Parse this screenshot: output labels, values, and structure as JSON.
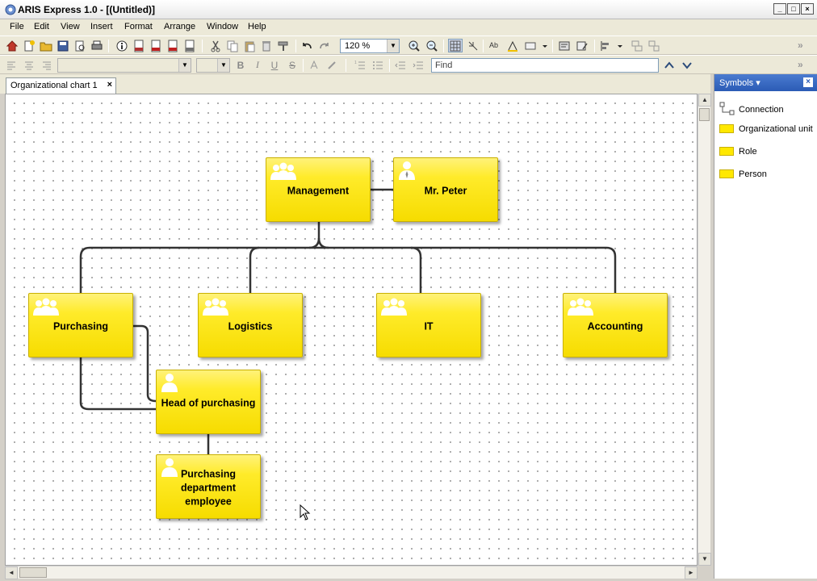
{
  "window": {
    "title": "ARIS Express 1.0 - [(Untitled)]",
    "minimize": "_",
    "maximize": "□",
    "close": "×"
  },
  "menu": [
    "File",
    "Edit",
    "View",
    "Insert",
    "Format",
    "Arrange",
    "Window",
    "Help"
  ],
  "toolbar": {
    "zoom": "120 %",
    "find_placeholder": "Find",
    "bold": "B",
    "italic": "I",
    "underline": "U",
    "strike": "S"
  },
  "tab": {
    "label": "Organizational chart 1",
    "close": "×"
  },
  "diagram": {
    "nodes": [
      {
        "label": "Management",
        "kind": "organizational-unit"
      },
      {
        "label": "Mr. Peter",
        "kind": "person"
      },
      {
        "label": "Purchasing",
        "kind": "organizational-unit"
      },
      {
        "label": "Logistics",
        "kind": "organizational-unit"
      },
      {
        "label": "IT",
        "kind": "organizational-unit"
      },
      {
        "label": "Accounting",
        "kind": "organizational-unit"
      },
      {
        "label": "Head of purchasing",
        "kind": "role"
      },
      {
        "label": "Purchasing department employee",
        "kind": "role"
      }
    ],
    "node_color": "#ffe800"
  },
  "symbols": {
    "title": "Symbols ▾",
    "close": "×",
    "items": [
      {
        "label": "Connection",
        "icon": "connection-icon"
      },
      {
        "label": "Organizational unit",
        "icon": "organizational-unit-swatch"
      },
      {
        "label": "Role",
        "icon": "role-swatch"
      },
      {
        "label": "Person",
        "icon": "person-swatch"
      }
    ]
  }
}
